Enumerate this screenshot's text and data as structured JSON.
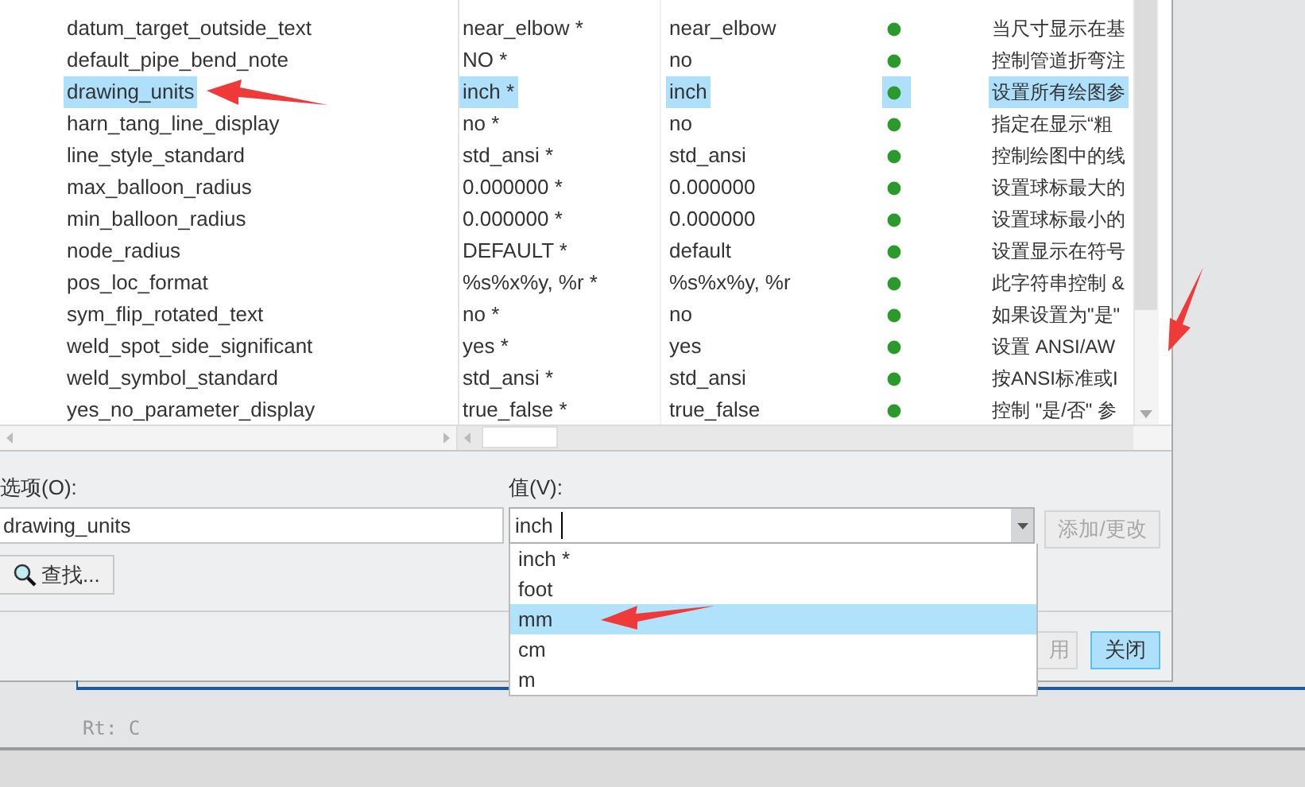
{
  "table": {
    "rows": [
      {
        "name": "datum_target_outside_text",
        "value": "near_elbow *",
        "default": "near_elbow",
        "description": "当尺寸显示在基",
        "selected": false
      },
      {
        "name": "default_pipe_bend_note",
        "value": "NO *",
        "default": "no",
        "description": "控制管道折弯注",
        "selected": false
      },
      {
        "name": "drawing_units",
        "value": "inch *",
        "default": "inch",
        "description": "设置所有绘图参",
        "selected": true
      },
      {
        "name": "harn_tang_line_display",
        "value": "no *",
        "default": "no",
        "description": "指定在显示“粗",
        "selected": false
      },
      {
        "name": "line_style_standard",
        "value": "std_ansi *",
        "default": "std_ansi",
        "description": "控制绘图中的线",
        "selected": false
      },
      {
        "name": "max_balloon_radius",
        "value": "0.000000 *",
        "default": "0.000000",
        "description": "设置球标最大的",
        "selected": false
      },
      {
        "name": "min_balloon_radius",
        "value": "0.000000 *",
        "default": "0.000000",
        "description": "设置球标最小的",
        "selected": false
      },
      {
        "name": "node_radius",
        "value": "DEFAULT *",
        "default": "default",
        "description": "设置显示在符号",
        "selected": false
      },
      {
        "name": "pos_loc_format",
        "value": "%s%x%y, %r *",
        "default": "%s%x%y, %r",
        "description": "此字符串控制 &",
        "selected": false
      },
      {
        "name": "sym_flip_rotated_text",
        "value": "no *",
        "default": "no",
        "description": "如果设置为\"是\"",
        "selected": false
      },
      {
        "name": "weld_spot_side_significant",
        "value": "yes *",
        "default": "yes",
        "description": "设置 ANSI/AW",
        "selected": false
      },
      {
        "name": "weld_symbol_standard",
        "value": "std_ansi *",
        "default": "std_ansi",
        "description": "按ANSI标准或I",
        "selected": false
      },
      {
        "name": "yes_no_parameter_display",
        "value": "true_false *",
        "default": "true_false",
        "description": "控制 \"是/否\" 参",
        "selected": false
      }
    ]
  },
  "option": {
    "label": "选项(O):",
    "value": "drawing_units"
  },
  "find_button": {
    "label": "查找..."
  },
  "value_field": {
    "label": "值(V):",
    "value": "inch"
  },
  "add_button": {
    "label": "添加/更改",
    "disabled": true
  },
  "dropdown": {
    "items": [
      {
        "label": "inch *",
        "selected": false
      },
      {
        "label": "foot",
        "selected": false
      },
      {
        "label": "mm",
        "selected": true
      },
      {
        "label": "cm",
        "selected": false
      },
      {
        "label": "m",
        "selected": false
      }
    ]
  },
  "apply_button": {
    "label": "用",
    "disabled": true
  },
  "close_button": {
    "label": "关闭",
    "disabled": false
  },
  "status_bar": {
    "text": "Rt: C"
  }
}
